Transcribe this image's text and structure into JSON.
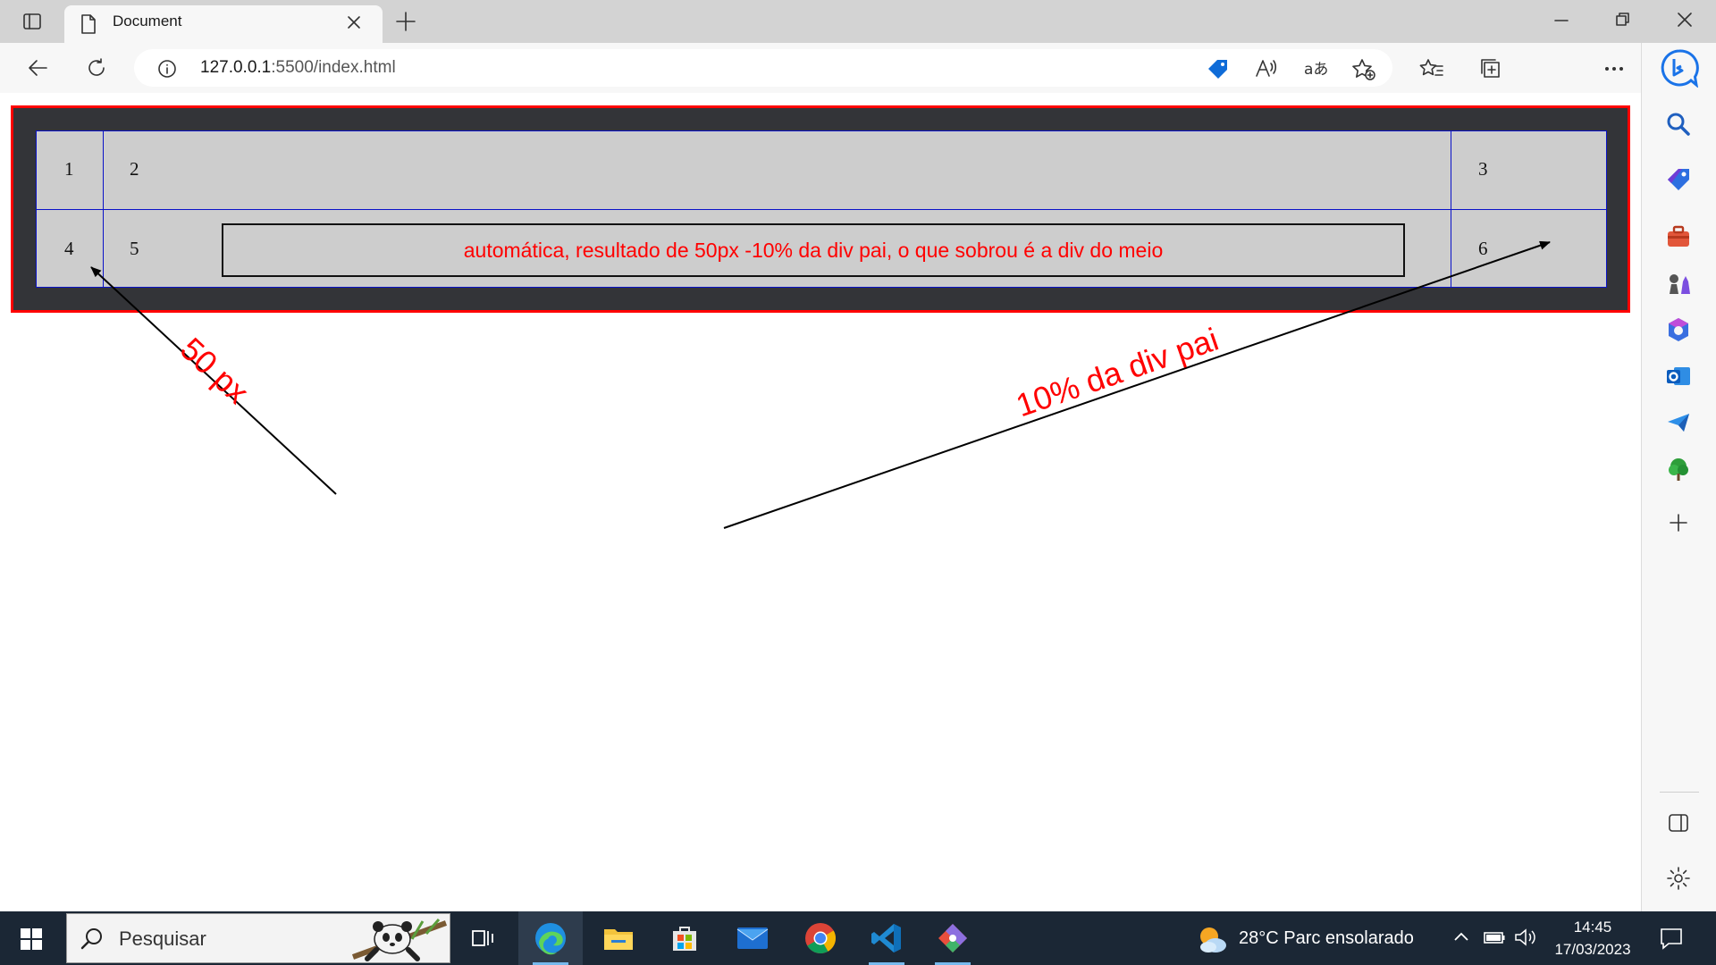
{
  "browser": {
    "tab_title": "Document",
    "url_host": "127.0.0.1",
    "url_path": ":5500/index.html"
  },
  "page": {
    "cells": [
      "1",
      "2",
      "3",
      "4",
      "5",
      "6"
    ],
    "inner_box_text": "automática, resultado de 50px -10% da div pai, o que sobrou é a div do meio",
    "annotation_left": "50 px",
    "annotation_right": "10% da div pai",
    "colors": {
      "container_border": "#ff0000",
      "container_bg": "#333438",
      "grid_bg": "#cdcdcd",
      "grid_lines": "#0a12c8",
      "annotation": "#ff0000"
    }
  },
  "taskbar": {
    "search_placeholder": "Pesquisar",
    "weather": "28°C  Parc ensolarado",
    "time": "14:45",
    "date": "17/03/2023",
    "apps": [
      "task-view",
      "edge",
      "file-explorer",
      "microsoft-store",
      "mail",
      "chrome",
      "vscode",
      "git-app"
    ]
  }
}
